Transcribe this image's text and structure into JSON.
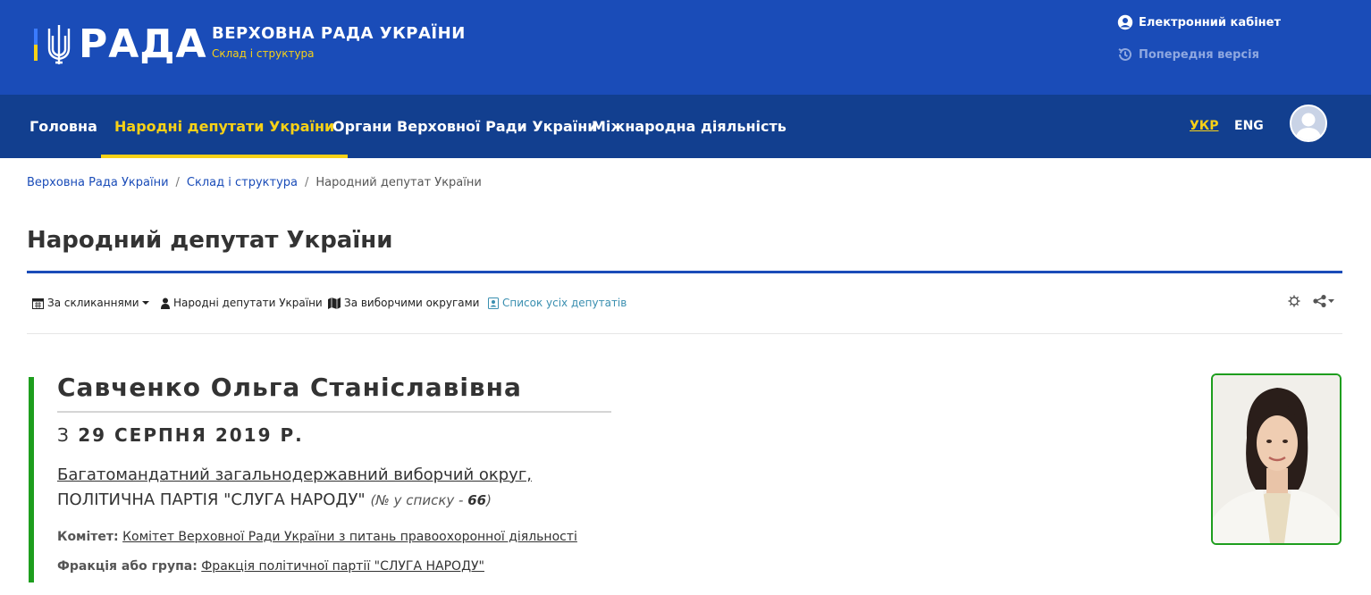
{
  "header": {
    "logo_word": "РАДА",
    "site_title": "ВЕРХОВНА РАДА УКРАЇНИ",
    "site_subtitle": "Склад і структура",
    "cabinet_label": "Електронний кабінет",
    "previous_version_label": "Попередня версія"
  },
  "nav": {
    "items": [
      {
        "label": "Головна"
      },
      {
        "label": "Народні депутати України"
      },
      {
        "label": "Органи Верховної Ради України"
      },
      {
        "label": "Міжнародна діяльність"
      }
    ],
    "active_item": "Народні депутати України",
    "languages": [
      "УКР",
      "ENG"
    ],
    "active_language": "УКР"
  },
  "breadcrumb": [
    "Верховна Рада України",
    "Склад і структура",
    "Народний депутат України"
  ],
  "page_title": "Народний депутат України",
  "toolbar": {
    "convocations": "За скликаннями",
    "deputies": "Народні депутати України",
    "districts": "За виборчими округами",
    "all_list": "Список усіх депутатів"
  },
  "deputy": {
    "name": "Савченко Ольга Станіславівна",
    "since_prefix": "З",
    "since_date": "29 СЕРПНЯ 2019 Р.",
    "district_line1": "Багатомандатний загальнодержавний виборчий округ,",
    "district_line2": "ПОЛІТИЧНА ПАРТІЯ \"СЛУГА НАРОДУ\"",
    "list_prefix": "(№ у списку - ",
    "list_number": "66",
    "list_suffix": ")",
    "committee_label": "Комітет:",
    "committee_value": "Комітет Верховної Ради України з питань правоохоронної діяльності",
    "faction_label": "Фракція або група:",
    "faction_value": "Фракція політичної партії \"СЛУГА НАРОДУ\""
  },
  "colors": {
    "header_blue": "#1a4cb8",
    "nav_blue": "#123f8f",
    "accent_yellow": "#f7d117",
    "deputy_green": "#1e9e1e"
  }
}
